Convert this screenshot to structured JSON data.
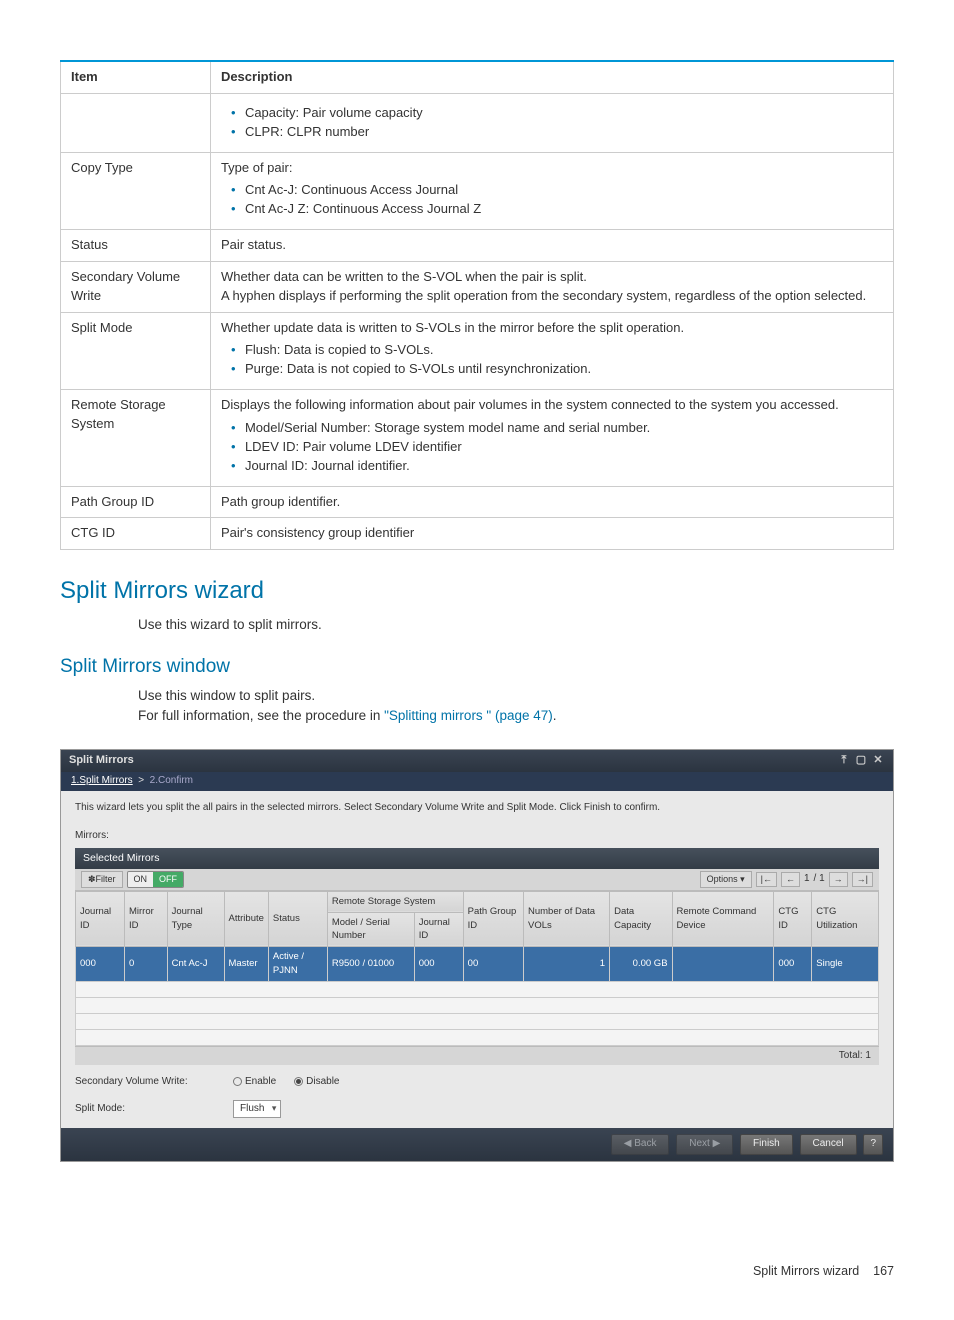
{
  "table": {
    "headers": [
      "Item",
      "Description"
    ],
    "rows": [
      {
        "item": "",
        "desc_intro": "",
        "bullets": [
          "Capacity: Pair volume capacity",
          "CLPR: CLPR number"
        ]
      },
      {
        "item": "Copy Type",
        "desc_intro": "Type of pair:",
        "bullets": [
          "Cnt Ac-J: Continuous Access Journal",
          "Cnt Ac-J Z: Continuous Access Journal Z"
        ]
      },
      {
        "item": "Status",
        "desc_intro": "Pair status.",
        "bullets": []
      },
      {
        "item": "Secondary Volume Write",
        "desc_intro": "Whether data can be written to the S-VOL when the pair is split.",
        "desc_extra": "A hyphen displays if performing the split operation from the secondary system, regardless of the option selected.",
        "bullets": []
      },
      {
        "item": "Split Mode",
        "desc_intro": "Whether update data is written to S-VOLs in the mirror before the split operation.",
        "bullets": [
          "Flush: Data is copied to S-VOLs.",
          "Purge: Data is not copied to S-VOLs until resynchronization."
        ]
      },
      {
        "item": "Remote Storage System",
        "desc_intro": "Displays the following information about pair volumes in the system connected to the system you accessed.",
        "bullets": [
          "Model/Serial Number: Storage system model name and serial number.",
          "LDEV ID: Pair volume LDEV identifier",
          "Journal ID: Journal identifier."
        ]
      },
      {
        "item": "Path Group ID",
        "desc_intro": "Path group identifier.",
        "bullets": []
      },
      {
        "item": "CTG ID",
        "desc_intro": "Pair's consistency group identifier",
        "bullets": []
      }
    ]
  },
  "sections": {
    "h1": "Split Mirrors wizard",
    "h1_body": "Use this wizard to split mirrors.",
    "h2": "Split Mirrors window",
    "h2_body1": "Use this window to split pairs.",
    "h2_body2_pre": "For full information, see the procedure in ",
    "h2_link": "\"Splitting mirrors \" (page 47)",
    "h2_body2_post": "."
  },
  "wizard": {
    "title": "Split Mirrors",
    "crumb_active": "1.Split Mirrors",
    "crumb_sep": ">",
    "crumb_inactive": "2.Confirm",
    "instruction": "This wizard lets you split the all pairs in the selected mirrors. Select Secondary Volume Write and Split Mode. Click Finish to confirm.",
    "mirrors_label": "Mirrors:",
    "panel_title": "Selected Mirrors",
    "filter_label": "✽Filter",
    "toggle_on": "ON",
    "toggle_off": "OFF",
    "options_btn": "Options ▾",
    "page_current": "1",
    "page_total": "/ 1",
    "grid_headers": {
      "journal_id": "Journal ID",
      "mirror_id": "Mirror ID",
      "journal_type": "Journal Type",
      "attribute": "Attribute",
      "status": "Status",
      "remote_group": "Remote Storage System",
      "remote_model": "Model / Serial Number",
      "remote_journal": "Journal ID",
      "path_group": "Path Group ID",
      "num_data_vols": "Number of Data VOLs",
      "data_capacity": "Data Capacity",
      "remote_cmd": "Remote Command Device",
      "ctg_id": "CTG ID",
      "ctg_util": "CTG Utilization"
    },
    "row": {
      "journal_id": "000",
      "mirror_id": "0",
      "journal_type": "Cnt Ac-J",
      "attribute": "Master",
      "status": "Active / PJNN",
      "remote_model": "R9500 / 01000",
      "remote_journal": "000",
      "path_group": "00",
      "num_data_vols": "1",
      "data_capacity": "0.00 GB",
      "remote_cmd": "",
      "ctg_id": "000",
      "ctg_util": "Single"
    },
    "total_label": "Total: 1",
    "svw_label": "Secondary Volume Write:",
    "svw_enable": "Enable",
    "svw_disable": "Disable",
    "splitmode_label": "Split Mode:",
    "splitmode_value": "Flush",
    "btn_back": "◀ Back",
    "btn_next": "Next ▶",
    "btn_finish": "Finish",
    "btn_cancel": "Cancel",
    "btn_help": "?"
  },
  "footer": {
    "text": "Split Mirrors wizard",
    "page": "167"
  }
}
